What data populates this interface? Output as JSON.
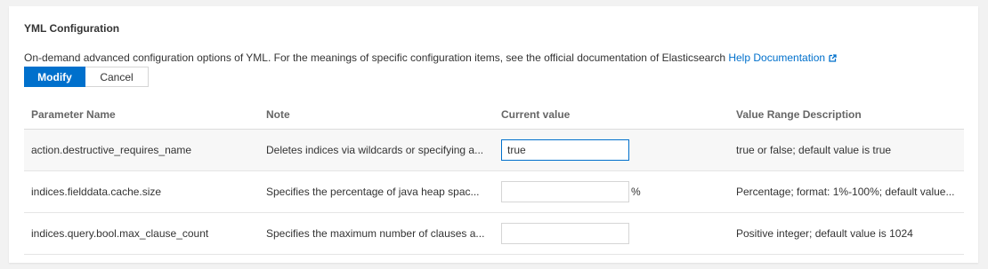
{
  "section": {
    "title": "YML Configuration",
    "description": "On-demand advanced configuration options of YML. For the meanings of specific configuration items, see the official documentation of Elasticsearch",
    "help_link": "Help Documentation",
    "help_icon": "external-link-icon"
  },
  "actions": {
    "modify_label": "Modify",
    "cancel_label": "Cancel"
  },
  "table": {
    "headers": {
      "name": "Parameter Name",
      "note": "Note",
      "value": "Current value",
      "range": "Value Range Description"
    },
    "rows": [
      {
        "name": "action.destructive_requires_name",
        "note": "Deletes indices via wildcards or specifying a...",
        "value": "true",
        "unit": "",
        "range": "true or false; default value is true"
      },
      {
        "name": "indices.fielddata.cache.size",
        "note": "Specifies the percentage of java heap spac...",
        "value": "",
        "unit": "%",
        "range": "Percentage; format: 1%-100%; default value..."
      },
      {
        "name": "indices.query.bool.max_clause_count",
        "note": "Specifies the maximum number of clauses a...",
        "value": "",
        "unit": "",
        "range": "Positive integer; default value is 1024"
      }
    ]
  },
  "colors": {
    "accent": "#0070cc",
    "text": "#333333",
    "header_text": "#666666",
    "background": "#f2f2f2"
  }
}
